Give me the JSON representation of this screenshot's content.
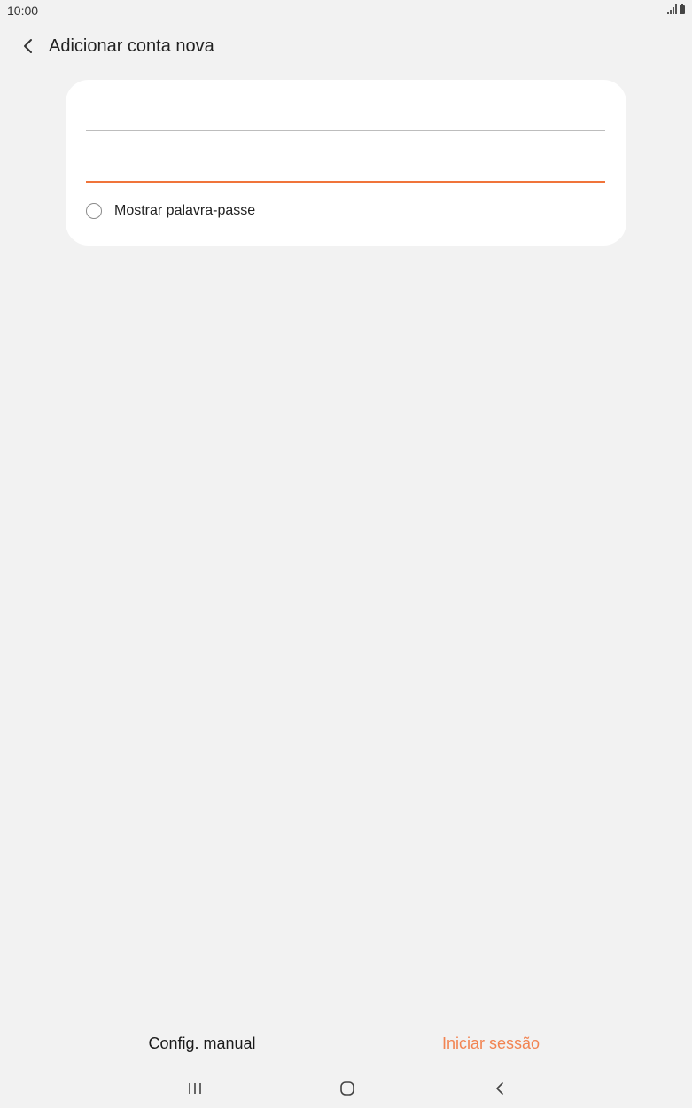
{
  "status_bar": {
    "time": "10:00",
    "icons": [
      "signal-icon",
      "battery-icon"
    ]
  },
  "app_bar": {
    "back_icon": "chevron-left-icon",
    "title": "Adicionar conta nova"
  },
  "form": {
    "email_field": {
      "value": "",
      "placeholder": ""
    },
    "password_field": {
      "value": "",
      "placeholder": "",
      "focused": true
    },
    "show_password": {
      "label": "Mostrar palavra-passe",
      "checked": false
    }
  },
  "actions": {
    "manual_setup_label": "Config. manual",
    "sign_in_label": "Iniciar sessão"
  },
  "nav_bar": {
    "icons": [
      "recents-icon",
      "home-icon",
      "back-icon"
    ]
  },
  "colors": {
    "background": "#f2f2f2",
    "card": "#ffffff",
    "accent": "#f0743a",
    "sign_in_text": "#f28452"
  }
}
